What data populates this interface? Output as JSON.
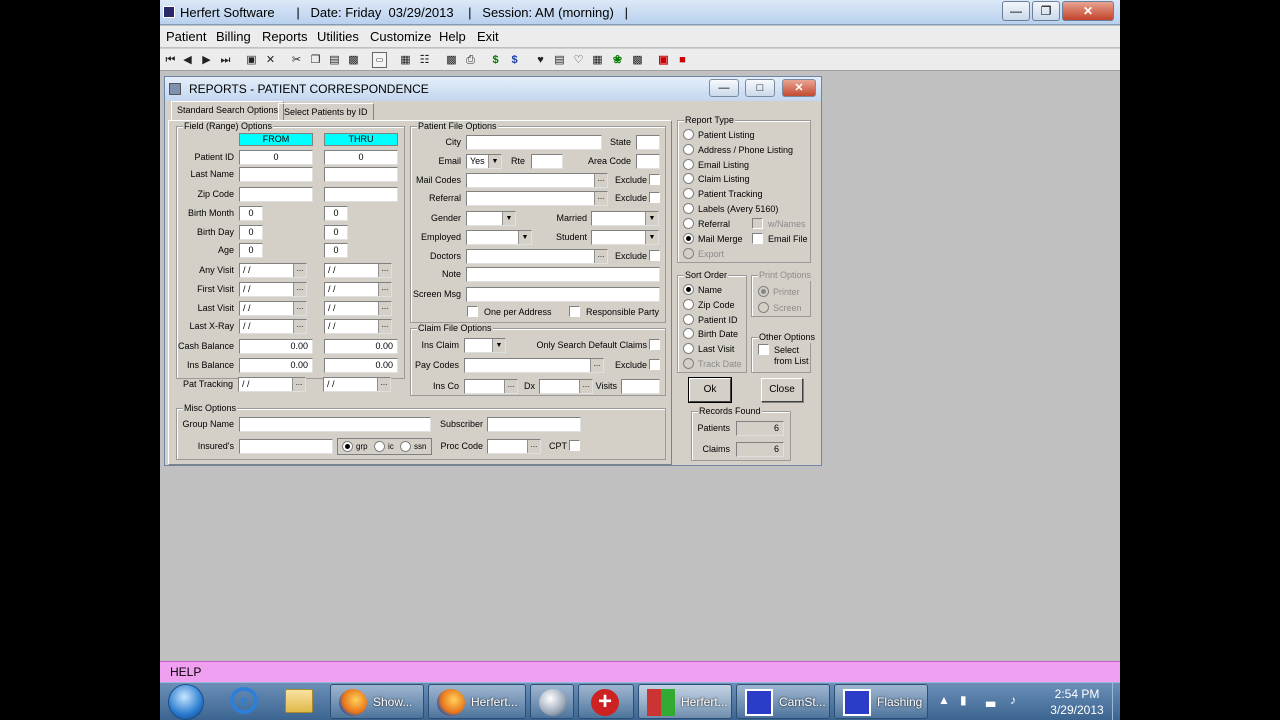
{
  "app": {
    "title": "Herfert Software      |   Date: Friday  03/29/2013    |   Session: AM (morning)   |",
    "menu": [
      "Patient",
      "Billing",
      "Reports",
      "Utilities",
      "Customize",
      "Help",
      "Exit"
    ],
    "toolbar_icons": [
      "first-record-icon",
      "prev-record-icon",
      "next-record-icon",
      "last-record-icon",
      "save-icon",
      "delete-icon",
      "cut-icon",
      "copy-icon",
      "paste-icon",
      "paste-special-icon",
      "screen-icon",
      "calc-icon",
      "notes-icon",
      "chart-icon",
      "print-icon",
      "payment-icon",
      "credit-icon",
      "heart-icon",
      "schedule-icon",
      "tooth-icon",
      "report-icon",
      "dollar-box-icon",
      "lock-icon",
      "exit-icon"
    ],
    "help_label": "HELP"
  },
  "dialog": {
    "title": "REPORTS - PATIENT CORRESPONDENCE",
    "tabs": [
      "Standard Search Options",
      "Select Patients by ID"
    ],
    "range": {
      "title": "Field (Range) Options",
      "from_header": "FROM",
      "thru_header": "THRU",
      "patient_id": {
        "label": "Patient ID",
        "from": "0",
        "thru": "0"
      },
      "last_name": {
        "label": "Last Name",
        "from": "",
        "thru": ""
      },
      "zip_code": {
        "label": "Zip Code",
        "from": "",
        "thru": ""
      },
      "birth_month": {
        "label": "Birth Month",
        "from": "0",
        "thru": "0"
      },
      "birth_day": {
        "label": "Birth Day",
        "from": "0",
        "thru": "0"
      },
      "age": {
        "label": "Age",
        "from": "0",
        "thru": "0"
      },
      "any_visit": {
        "label": "Any Visit",
        "from": " / /",
        "thru": " / /"
      },
      "first_visit": {
        "label": "First Visit",
        "from": " / /",
        "thru": " / /"
      },
      "last_visit": {
        "label": "Last Visit",
        "from": " / /",
        "thru": " / /"
      },
      "last_xray": {
        "label": "Last X-Ray",
        "from": " / /",
        "thru": " / /"
      },
      "cash_balance": {
        "label": "Cash Balance",
        "from": "0.00",
        "thru": "0.00"
      },
      "ins_balance": {
        "label": "Ins Balance",
        "from": "0.00",
        "thru": "0.00"
      },
      "pat_tracking": {
        "label": "Pat Tracking",
        "from": " / /",
        "thru": " / /"
      }
    },
    "patient_file": {
      "title": "Patient File Options",
      "city_label": "City",
      "state_label": "State",
      "email_label": "Email",
      "email_value": "Yes",
      "rte_label": "Rte",
      "area_code_label": "Area Code",
      "mail_codes_label": "Mail Codes",
      "referral_label": "Referral",
      "exclude_label": "Exclude",
      "gender_label": "Gender",
      "married_label": "Married",
      "employed_label": "Employed",
      "student_label": "Student",
      "doctors_label": "Doctors",
      "note_label": "Note",
      "screen_msg_label": "Screen Msg",
      "one_per_address": "One per Address",
      "responsible_party": "Responsible Party"
    },
    "claim_file": {
      "title": "Claim File Options",
      "ins_claim_label": "Ins Claim",
      "only_search_default": "Only Search Default Claims",
      "pay_codes_label": "Pay Codes",
      "exclude_label": "Exclude",
      "ins_co_label": "Ins Co",
      "dx_label": "Dx",
      "visits_label": "Visits"
    },
    "misc": {
      "title": "Misc Options",
      "group_name_label": "Group Name",
      "subscriber_label": "Subscriber",
      "insureds_label": "Insured's",
      "radio_grp": "grp",
      "radio_ic": "ic",
      "radio_ssn": "ssn",
      "proc_code_label": "Proc Code",
      "cpt_label": "CPT"
    },
    "report_type": {
      "title": "Report Type",
      "options": [
        "Patient Listing",
        "Address / Phone Listing",
        "Email Listing",
        "Claim Listing",
        "Patient Tracking",
        "Labels (Avery 5160)",
        "Referral",
        "Mail Merge",
        "Export"
      ],
      "selected": "Mail Merge",
      "wnames_label": "w/Names",
      "email_file_label": "Email File"
    },
    "sort_order": {
      "title": "Sort Order",
      "options": [
        "Name",
        "Zip Code",
        "Patient ID",
        "Birth Date",
        "Last Visit",
        "Track Date"
      ],
      "selected": "Name"
    },
    "print_options": {
      "title": "Print Options",
      "options": [
        "Printer",
        "Screen"
      ],
      "selected": "Printer"
    },
    "other_options": {
      "title": "Other Options",
      "select_from_list_1": "Select",
      "select_from_list_2": "from List"
    },
    "ok_label": "Ok",
    "close_label": "Close",
    "records_found": {
      "title": "Records Found",
      "patients_label": "Patients",
      "patients_value": "6",
      "claims_label": "Claims",
      "claims_value": "6"
    }
  },
  "taskbar": {
    "items": [
      {
        "label": "Show...",
        "icon": "firefox-icon"
      },
      {
        "label": "Herfert...",
        "icon": "firefox-icon"
      },
      {
        "label": "",
        "icon": "globe-mail-icon"
      },
      {
        "label": "",
        "icon": "medical-plus-icon"
      },
      {
        "label": "Herfert...",
        "icon": "herfert-app-icon"
      },
      {
        "label": "CamSt...",
        "icon": "camstudio-icon"
      },
      {
        "label": "Flashing",
        "icon": "camstudio-icon"
      }
    ],
    "time": "2:54 PM",
    "date": "3/29/2013"
  }
}
